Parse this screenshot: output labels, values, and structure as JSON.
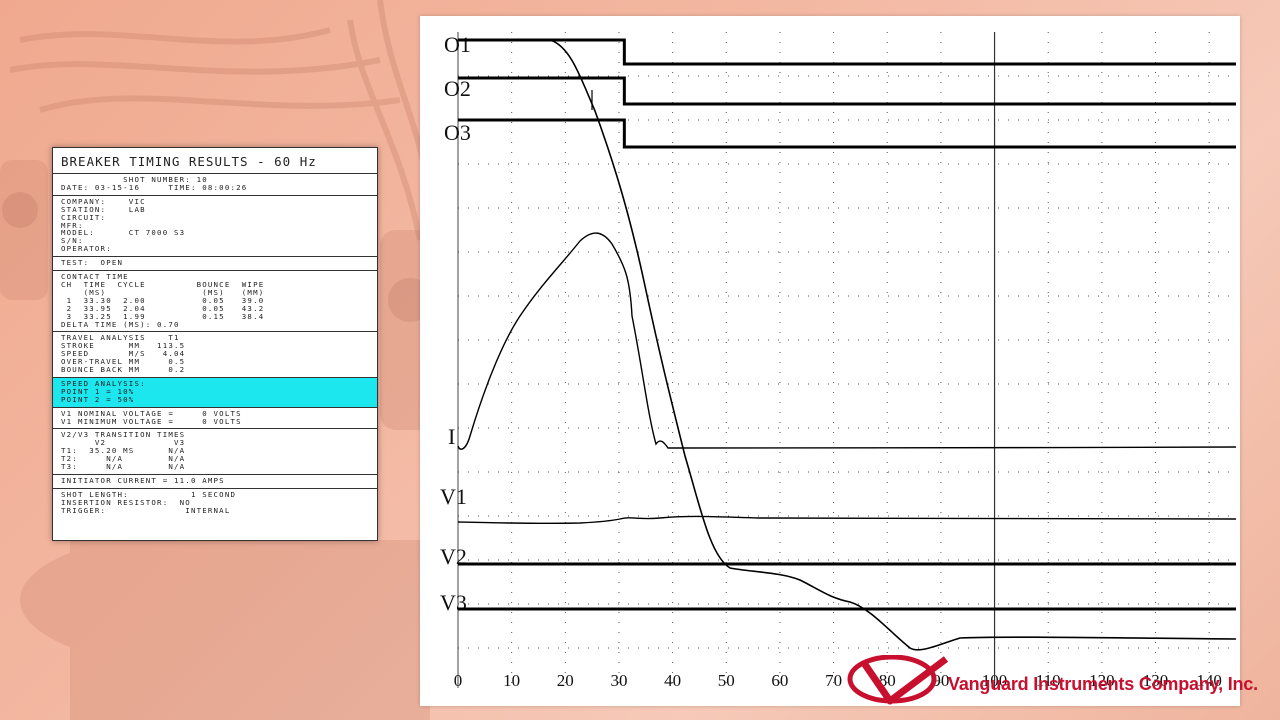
{
  "report": {
    "title": "BREAKER TIMING RESULTS - 60 Hz",
    "header": [
      "           SHOT NUMBER: 10",
      "DATE: 03-15-16     TIME: 08:00:26"
    ],
    "info": [
      "COMPANY:    VIC",
      "STATION:    LAB",
      "CIRCUIT:",
      "MFR:",
      "MODEL:      CT 7000 S3",
      "S/N:",
      "OPERATOR:"
    ],
    "test": "TEST:  OPEN",
    "contact": [
      "CONTACT TIME",
      "CH  TIME  CYCLE         BOUNCE  WIPE",
      "    (mS)                 (mS)   (mm)",
      " 1  33.30  2.00          0.05   39.0",
      " 2  33.95  2.04          0.05   43.2",
      " 3  33.25  1.99          0.15   38.4",
      "",
      "DELTA TIME (mS): 0.70"
    ],
    "travel": [
      "TRAVEL ANALYSIS    T1",
      "STROKE      mm   113.5",
      "SPEED       M/S   4.04",
      "OVER-TRAVEL mm     0.5",
      "BOUNCE BACK mm     0.2"
    ],
    "speed": [
      "SPEED ANALYSIS:",
      "POINT 1 = 10%",
      "POINT 2 = 50%"
    ],
    "voltage": [
      "V1 NOMINAL VOLTAGE =     0 VOLTS",
      "V1 MINIMUM VOLTAGE =     0 VOLTS"
    ],
    "transition": [
      "V2/V3 TRANSITION TIMES",
      "",
      "      V2            V3",
      "T1:  35.20 mS      N/A",
      "T2:     N/A        N/A",
      "T3:     N/A        N/A"
    ],
    "initiator": "INITIATOR CURRENT = 11.0 AMPS",
    "shot": [
      "SHOT LENGTH:           1 SECOND",
      "INSERTION RESISTOR:  NO",
      "TRIGGER:              INTERNAL"
    ]
  },
  "chart": {
    "channel_labels": [
      "O1",
      "O2",
      "O3",
      "I",
      "V1",
      "V2",
      "V3"
    ],
    "x_ticks": [
      "0",
      "10",
      "20",
      "30",
      "40",
      "50",
      "60",
      "70",
      "80",
      "90",
      "100",
      "110",
      "120",
      "130",
      "140"
    ],
    "colors": {
      "trace": "#000000",
      "grid": "#555555"
    }
  },
  "chart_data": {
    "type": "line",
    "x_ticks": [
      0,
      10,
      20,
      30,
      40,
      50,
      60,
      70,
      80,
      90,
      100,
      110,
      120,
      130,
      140
    ],
    "xlim": [
      0,
      145
    ],
    "cursor_x": 100,
    "series": [
      {
        "name": "O1",
        "transition_x": 31
      },
      {
        "name": "O2",
        "transition_x": 31
      },
      {
        "name": "O3",
        "transition_x": 31
      }
    ]
  },
  "logo": {
    "company": "Vanguard Instruments Company, Inc.",
    "brand_color": "#c8102e"
  }
}
